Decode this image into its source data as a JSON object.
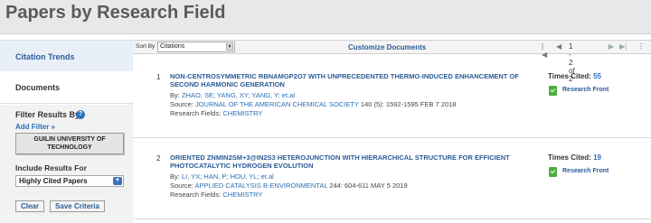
{
  "page": {
    "title": "Papers by Research Field"
  },
  "sidebar": {
    "tabs": [
      {
        "label": "Citation Trends"
      },
      {
        "label": "Documents"
      }
    ],
    "filter": {
      "heading": "Filter Results By",
      "help_icon": "question-icon",
      "add_filter": "Add Filter »",
      "chip_line1": "GUILIN UNIVERSITY OF",
      "chip_line2": "TECHNOLOGY",
      "include_label": "Include Results For",
      "include_value": "Highly Cited Papers",
      "clear_label": "Clear",
      "save_label": "Save Criteria"
    }
  },
  "toolbar": {
    "sortby_label": "Sort By",
    "sort_value": "Citations",
    "customize_label": "Customize Documents",
    "pager": {
      "first": "|◀",
      "prev": "◀",
      "count": "1 - 2 of 2",
      "next": "▶",
      "last": "▶|",
      "menu": "⋮"
    }
  },
  "records": [
    {
      "num": "1",
      "title": "NON-CENTROSYMMETRIC RBNAMGP2O7 WITH UNPRECEDENTED THERMO-INDUCED ENHANCEMENT OF SECOND HARMONIC GENERATION",
      "by_label": "By:",
      "authors": "ZHAO, SE;  YANG, XY;  YANG, Y;  et.al",
      "source_label": "Source:",
      "source": "JOURNAL OF THE AMERICAN CHEMICAL SOCIETY",
      "source_rest": " 140 (5): 1592-1595 FEB 7 2018",
      "fields_label": "Research Fields:",
      "fields": "CHEMISTRY",
      "times_cited_label": "Times Cited:",
      "times_cited": "55",
      "research_front": "Research Front"
    },
    {
      "num": "2",
      "title": "ORIENTED ZNMIN2SM+3@IN2S3 HETEROJUNCTION WITH HIERARCHICAL STRUCTURE FOR EFFICIENT PHOTOCATALYTIC HYDROGEN EVOLUTION",
      "by_label": "By:",
      "authors": "LI, YX;  HAN, P;  HOU, YL;  et.al",
      "source_label": "Source:",
      "source": "APPLIED CATALYSIS B-ENVIRONMENTAL",
      "source_rest": " 244: 604-611 MAY 5 2019",
      "fields_label": "Research Fields:",
      "fields": "CHEMISTRY",
      "times_cited_label": "Times Cited:",
      "times_cited": "19",
      "research_front": "Research Front"
    }
  ],
  "colors": {
    "accent": "#2a5b96",
    "link": "#2a6fb7",
    "research_front_icon": "#4caf3c"
  }
}
